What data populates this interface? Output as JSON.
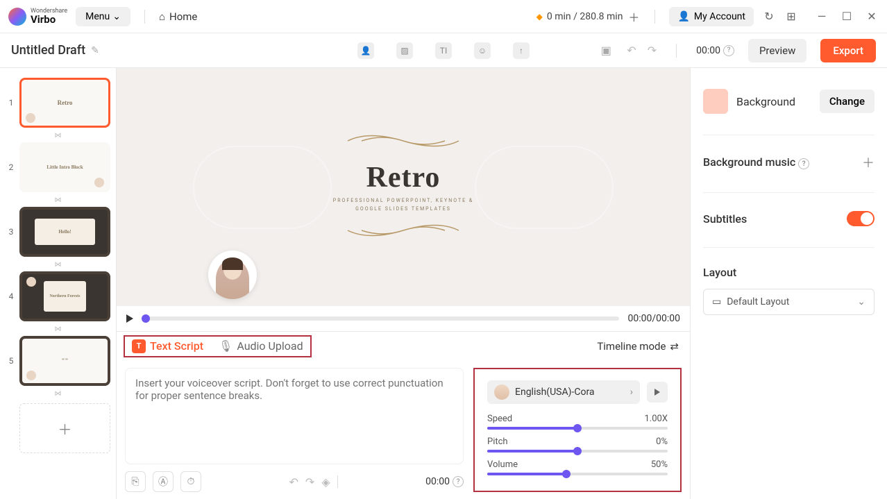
{
  "titlebar": {
    "brand": "Wondershare",
    "product": "Virbo",
    "menu_label": "Menu",
    "home_label": "Home",
    "time_used": "0 min / 280.8 min",
    "account_label": "My Account"
  },
  "toolbar": {
    "draft_name": "Untitled Draft",
    "duration": "00:00",
    "preview_label": "Preview",
    "export_label": "Export"
  },
  "slides": {
    "items": [
      {
        "num": "1",
        "title": "Retro"
      },
      {
        "num": "2",
        "title": "Little Intro Block"
      },
      {
        "num": "3",
        "title": "Hello!"
      },
      {
        "num": "4",
        "title": "Northern Forests"
      },
      {
        "num": "5",
        "title": "\"\""
      }
    ]
  },
  "canvas": {
    "title": "Retro",
    "subtitle_line1": "PROFESSIONAL POWERPOINT, KEYNOTE &",
    "subtitle_line2": "GOOGLE SLIDES TEMPLATES"
  },
  "playback": {
    "time": "00:00/00:00"
  },
  "script": {
    "tab_text": "Text Script",
    "tab_audio": "Audio Upload",
    "timeline_label": "Timeline mode",
    "placeholder": "Insert your voiceover script. Don't forget to use correct punctuation for proper sentence breaks.",
    "footer_time": "00:00"
  },
  "voice": {
    "selected": "English(USA)-Cora",
    "speed_label": "Speed",
    "speed_value": "1.00X",
    "pitch_label": "Pitch",
    "pitch_value": "0%",
    "volume_label": "Volume",
    "volume_value": "50%"
  },
  "props": {
    "bg_label": "Background",
    "change_label": "Change",
    "music_label": "Background music",
    "subtitles_label": "Subtitles",
    "layout_heading": "Layout",
    "layout_default": "Default Layout"
  }
}
